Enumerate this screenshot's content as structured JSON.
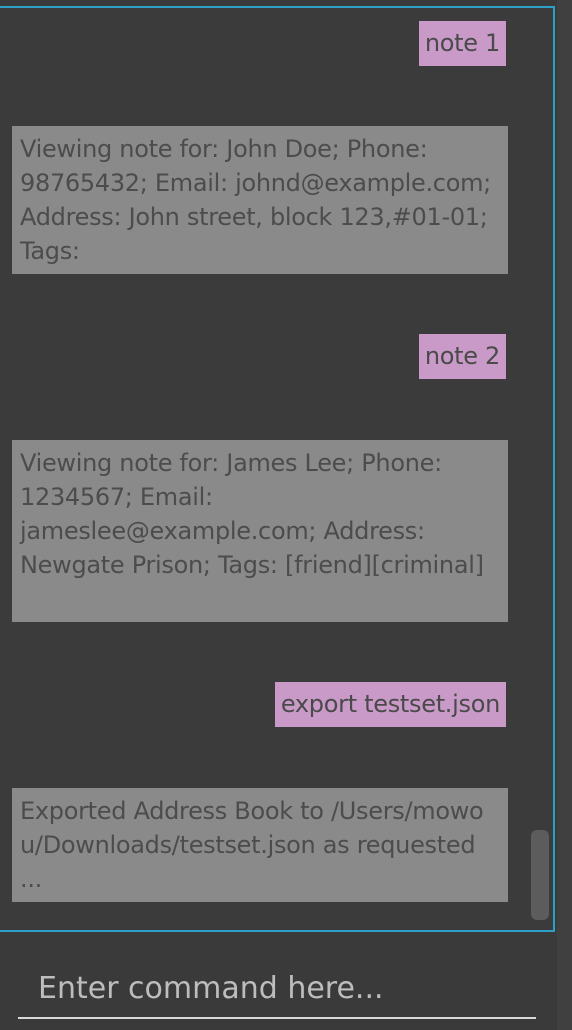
{
  "chat": {
    "messages": [
      {
        "role": "command",
        "text": "note 1"
      },
      {
        "role": "response",
        "text": "Viewing note for: John Doe; Phone: 98765432; Email: johnd@example.com; Address: John street, block 123,#01-01; Tags:"
      },
      {
        "role": "command",
        "text": "note 2"
      },
      {
        "role": "response",
        "text": "Viewing note for: James Lee; Phone: 1234567; Email: jameslee@example.com; Address: Newgate Prison; Tags: [friend][criminal]"
      },
      {
        "role": "command",
        "text": "export testset.json"
      },
      {
        "role": "response",
        "text": "Exported Address Book to /Users/mowou/Downloads/testset.json as requested ..."
      }
    ]
  },
  "input": {
    "placeholder": "Enter command here...",
    "value": ""
  },
  "colors": {
    "command_bubble": "#c99ac7",
    "response_bubble": "#8a8a8a",
    "panel_border": "#2e9fc7",
    "background": "#3a3a3a"
  }
}
